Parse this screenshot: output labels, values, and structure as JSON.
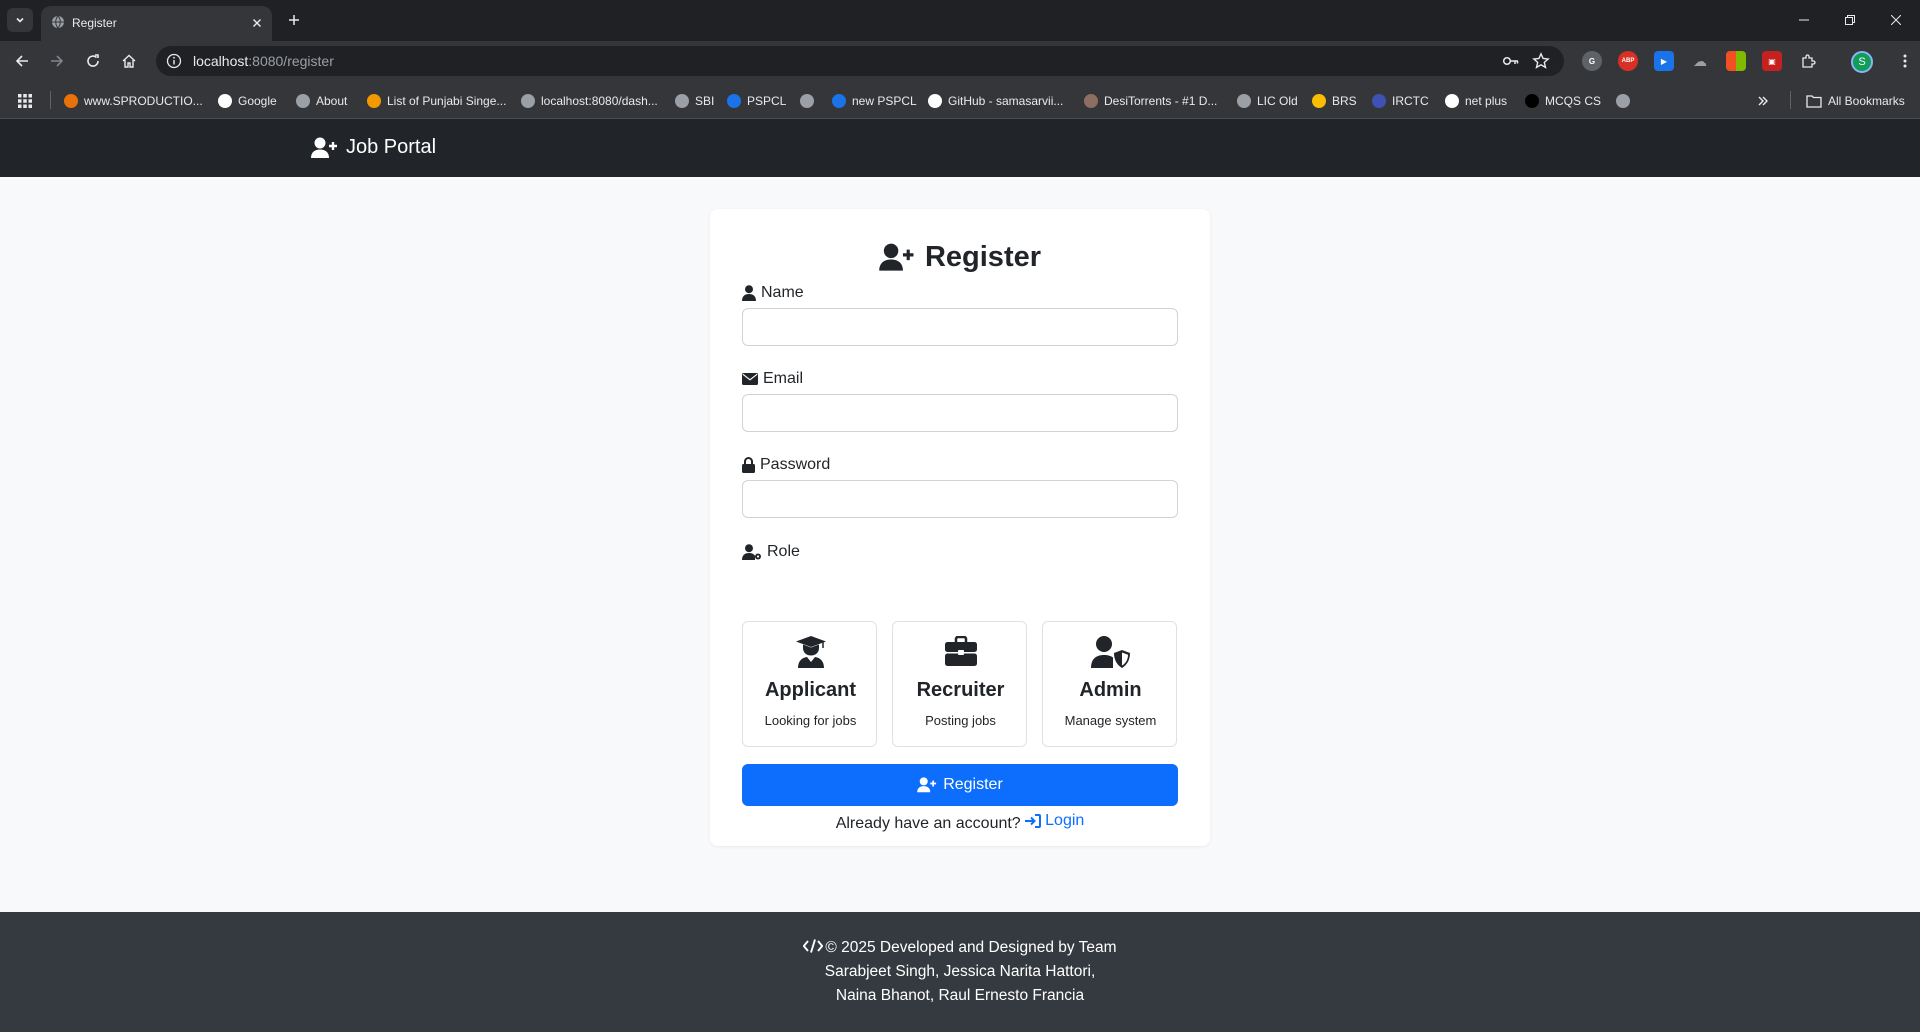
{
  "browser": {
    "tab_title": "Register",
    "url_host": "localhost",
    "url_rest": ":8080/register",
    "profile_initial": "S",
    "bookmarks": [
      {
        "label": "www.SPRODUCTIO...",
        "color": "#e8710a"
      },
      {
        "label": "Google",
        "color": "#ffffff"
      },
      {
        "label": "About",
        "color": "#9aa0a6"
      },
      {
        "label": "List of Punjabi Singe...",
        "color": "#f29900"
      },
      {
        "label": "localhost:8080/dash...",
        "color": "#9aa0a6"
      },
      {
        "label": "SBI",
        "color": "#9aa0a6"
      },
      {
        "label": "PSPCL",
        "color": "#1a73e8"
      },
      {
        "label": "",
        "color": "#9aa0a6"
      },
      {
        "label": "new PSPCL",
        "color": "#1a73e8"
      },
      {
        "label": "GitHub - samasarvii...",
        "color": "#ffffff"
      },
      {
        "label": "DesiTorrents - #1 D...",
        "color": "#8d6e63"
      },
      {
        "label": "LIC Old",
        "color": "#9aa0a6"
      },
      {
        "label": "BRS",
        "color": "#fbbc04"
      },
      {
        "label": "IRCTC",
        "color": "#3f51b5"
      },
      {
        "label": "net plus",
        "color": "#ffffff"
      },
      {
        "label": "MCQS CS",
        "color": "#000000"
      },
      {
        "label": "",
        "color": "#9aa0a6"
      }
    ],
    "all_bookmarks": "All Bookmarks"
  },
  "nav": {
    "brand": "Job Portal"
  },
  "form": {
    "title": "Register",
    "name_label": "Name",
    "email_label": "Email",
    "password_label": "Password",
    "role_label": "Role",
    "name_value": "",
    "email_value": "",
    "password_value": "",
    "roles": [
      {
        "name": "Applicant",
        "desc": "Looking for jobs",
        "icon": "user-graduate-icon"
      },
      {
        "name": "Recruiter",
        "desc": "Posting jobs",
        "icon": "briefcase-icon"
      },
      {
        "name": "Admin",
        "desc": "Manage system",
        "icon": "user-shield-icon"
      }
    ],
    "submit_label": "Register",
    "login_prompt": "Already have an account?",
    "login_link": "Login"
  },
  "footer": {
    "line1": "© 2025 Developed and Designed by Team",
    "line2": "Sarabjeet Singh, Jessica Narita Hattori,",
    "line3": "Naina Bhanot, Raul Ernesto Francia"
  },
  "colors": {
    "primary": "#0d6efd",
    "navbar": "#212529",
    "footer": "#343a40",
    "page_bg": "#f8f9fa"
  }
}
